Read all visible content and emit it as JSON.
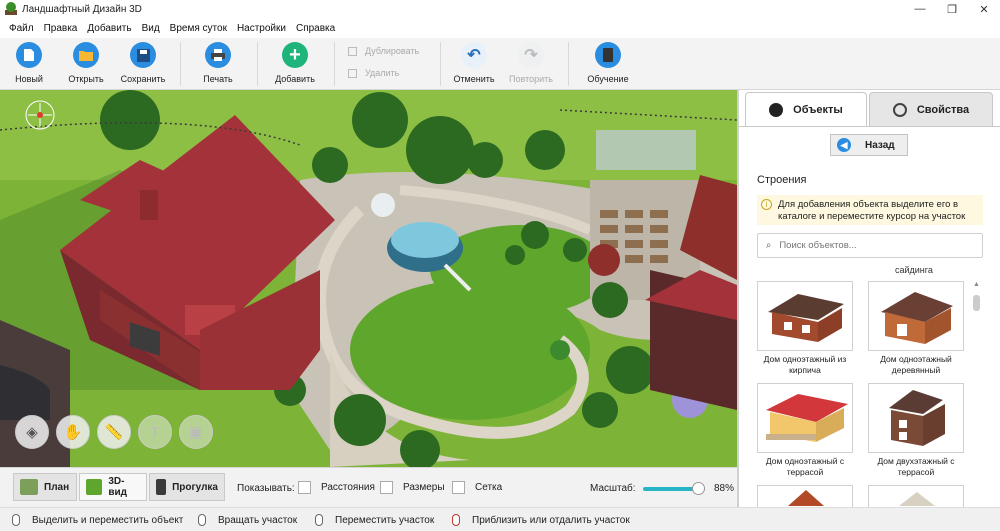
{
  "window": {
    "title": "Ландшафтный Дизайн 3D",
    "controls": [
      "—",
      "❐",
      "✕"
    ]
  },
  "menu": [
    "Файл",
    "Правка",
    "Добавить",
    "Вид",
    "Время суток",
    "Настройки",
    "Справка"
  ],
  "toolbar": {
    "new": "Новый",
    "open": "Открыть",
    "save": "Сохранить",
    "print": "Печать",
    "add": "Добавить",
    "duplicate": "Дублировать",
    "delete": "Удалить",
    "undo": "Отменить",
    "redo": "Повторить",
    "learn": "Обучение"
  },
  "view_modes": {
    "plan": "План",
    "view3d": "3D-вид",
    "walk": "Прогулка",
    "active": "3D-вид"
  },
  "show": {
    "label": "Показывать:",
    "distances": "Расстояния",
    "sizes": "Размеры",
    "grid": "Сетка",
    "distances_checked": false,
    "sizes_checked": false,
    "grid_checked": false
  },
  "zoom": {
    "label": "Масштаб:",
    "value": "88%",
    "level": 0.88
  },
  "status": {
    "select": "Выделить и переместить объект",
    "rotate": "Вращать участок",
    "move": "Переместить участок",
    "zoom": "Приблизить или отдалить участок"
  },
  "panel": {
    "tab_objects": "Объекты",
    "tab_properties": "Свойства",
    "back": "Назад",
    "section": "Строения",
    "hint": "Для добавления объекта выделите его в каталоге и переместите курсор на участок",
    "search_placeholder": "Поиск объектов...",
    "category": "сайдинга",
    "items": [
      {
        "caption": "Дом одноэтажный из кирпича"
      },
      {
        "caption": "Дом одноэтажный деревянный"
      },
      {
        "caption": "Дом одноэтажный с террасой"
      },
      {
        "caption": "Дом двухэтажный с террасой"
      },
      {
        "caption": ""
      },
      {
        "caption": ""
      }
    ]
  },
  "colors": {
    "accent": "#2a8de0",
    "slider": "#26b5c7",
    "roof": "#a3323a",
    "grass": "#5da12a"
  }
}
